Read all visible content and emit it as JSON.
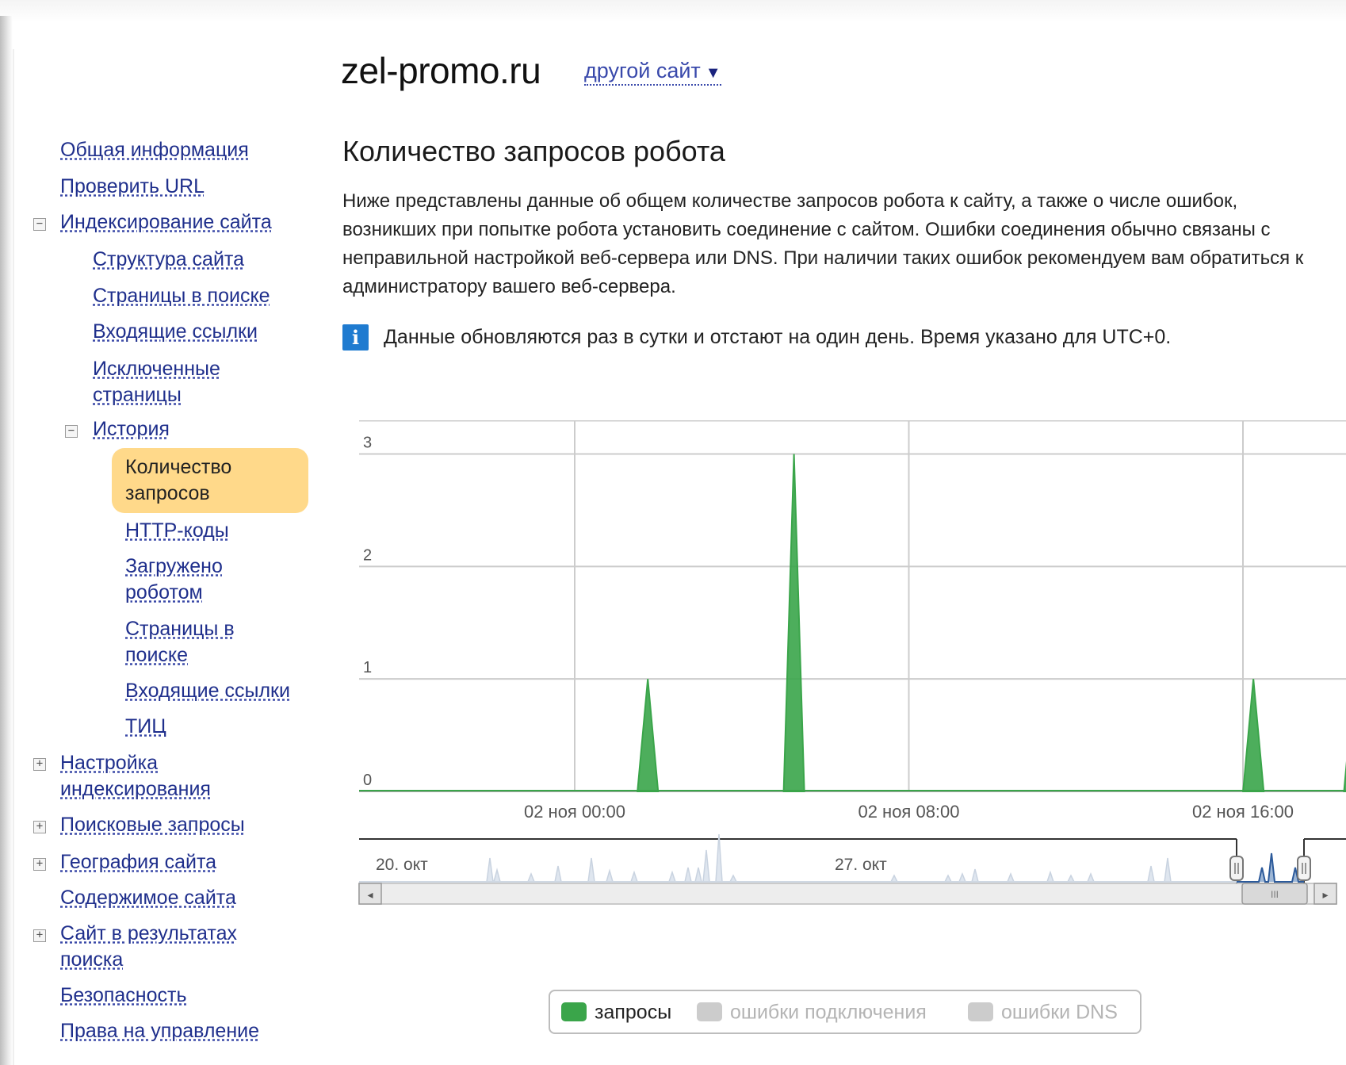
{
  "header": {
    "site": "zel-promo.ru",
    "other_site_label": "другой сайт",
    "other_site_arrow": "▼"
  },
  "sidebar": {
    "overview": "Общая информация",
    "check_url": "Проверить URL",
    "indexing": "Индексирование сайта",
    "site_structure": "Структура сайта",
    "pages_in_search": "Страницы в поиске",
    "inbound_links": "Входящие ссылки",
    "excluded_pages": [
      "Исключенные",
      "страницы"
    ],
    "history": "История",
    "history_items": {
      "requests": [
        "Количество",
        "запросов"
      ],
      "http_codes": "HTTP-коды",
      "downloaded": [
        "Загружено",
        "роботом"
      ],
      "pages_in_search": [
        "Страницы в",
        "поиске"
      ],
      "inbound_links": "Входящие ссылки",
      "tic": "ТИЦ"
    },
    "indexing_settings": [
      "Настройка",
      "индексирования"
    ],
    "search_queries": "Поисковые запросы",
    "geography": "География сайта",
    "site_content": "Содержимое сайта",
    "search_results": [
      "Сайт в результатах",
      "поиска"
    ],
    "security": "Безопасность",
    "rights": "Права на управление",
    "toggle_minus": "−",
    "toggle_plus": "+"
  },
  "main": {
    "heading": "Количество запросов робота",
    "description": "Ниже представлены данные об общем количестве запросов робота к сайту, а также о числе ошибок, возникших при попытке робота установить соединение с сайтом. Ошибки соединения обычно связаны с неправильной настройкой веб-сервера или DNS. При наличии таких ошибок рекомендуем вам обратиться к администратору вашего веб-сервера.",
    "info_icon": "i",
    "info_text": "Данные обновляются раз в сутки и отстают на один день. Время указано для UTC+0."
  },
  "chart_data": {
    "type": "area",
    "y_ticks": [
      "0",
      "1",
      "2",
      "3"
    ],
    "ylim": [
      0,
      3.3
    ],
    "x_ticks": [
      "02 ноя 00:00",
      "02 ноя 08:00",
      "02 ноя 16:00"
    ],
    "series": [
      {
        "name": "запросы",
        "color": "#3aa54a",
        "points": [
          {
            "x": "02 ноя 01:45",
            "y": 1
          },
          {
            "x": "02 ноя 05:15",
            "y": 3
          },
          {
            "x": "02 ноя 16:15",
            "y": 1
          },
          {
            "x": "02 ноя 18:40",
            "y": 1
          }
        ]
      }
    ],
    "navigator": {
      "labels": [
        "20. окт",
        "27. окт"
      ],
      "scroll_left": "◂",
      "scroll_right": "▸",
      "scroll_grip": "III"
    },
    "legend": [
      {
        "label": "запросы",
        "color": "#3aa54a",
        "active": true
      },
      {
        "label": "ошибки подключения",
        "color": "#cccccc",
        "active": false
      },
      {
        "label": "ошибки DNS",
        "color": "#cccccc",
        "active": false
      }
    ]
  }
}
